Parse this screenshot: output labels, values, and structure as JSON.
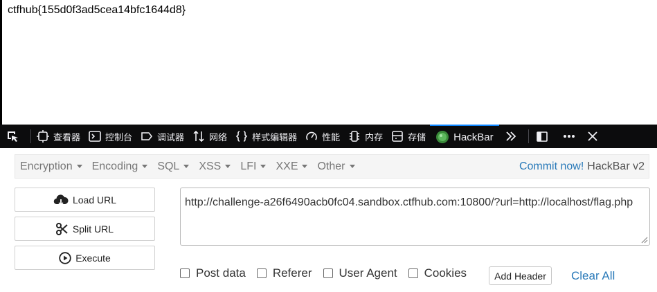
{
  "page": {
    "flag_text": "ctfhub{155d0f3ad5cea14bfc1644d8}"
  },
  "devtools": {
    "tabs": [
      {
        "label": "查看器",
        "icon": "inspector-icon"
      },
      {
        "label": "控制台",
        "icon": "console-icon"
      },
      {
        "label": "调试器",
        "icon": "debugger-icon"
      },
      {
        "label": "网络",
        "icon": "network-icon"
      },
      {
        "label": "样式编辑器",
        "icon": "style-editor-icon"
      },
      {
        "label": "性能",
        "icon": "performance-icon"
      },
      {
        "label": "内存",
        "icon": "memory-icon"
      },
      {
        "label": "存储",
        "icon": "storage-icon"
      },
      {
        "label": "HackBar",
        "icon": "hackbar-icon"
      }
    ]
  },
  "hackbar": {
    "menu": [
      "Encryption",
      "Encoding",
      "SQL",
      "XSS",
      "LFI",
      "XXE",
      "Other"
    ],
    "commit_link": "Commit now!",
    "version": "HackBar v2",
    "buttons": {
      "load": "Load URL",
      "split": "Split URL",
      "execute": "Execute"
    },
    "url_value": "http://challenge-a26f6490acb0fc04.sandbox.ctfhub.com:10800/?url=http://localhost/flag.php",
    "options": {
      "post": "Post data",
      "referer": "Referer",
      "user_agent": "User Agent",
      "cookies": "Cookies"
    },
    "add_header": "Add Header",
    "clear_all": "Clear All"
  },
  "colors": {
    "accent": "#0a84ff",
    "link": "#2a7ab9",
    "toolbar_bg": "#0c0c0d"
  }
}
